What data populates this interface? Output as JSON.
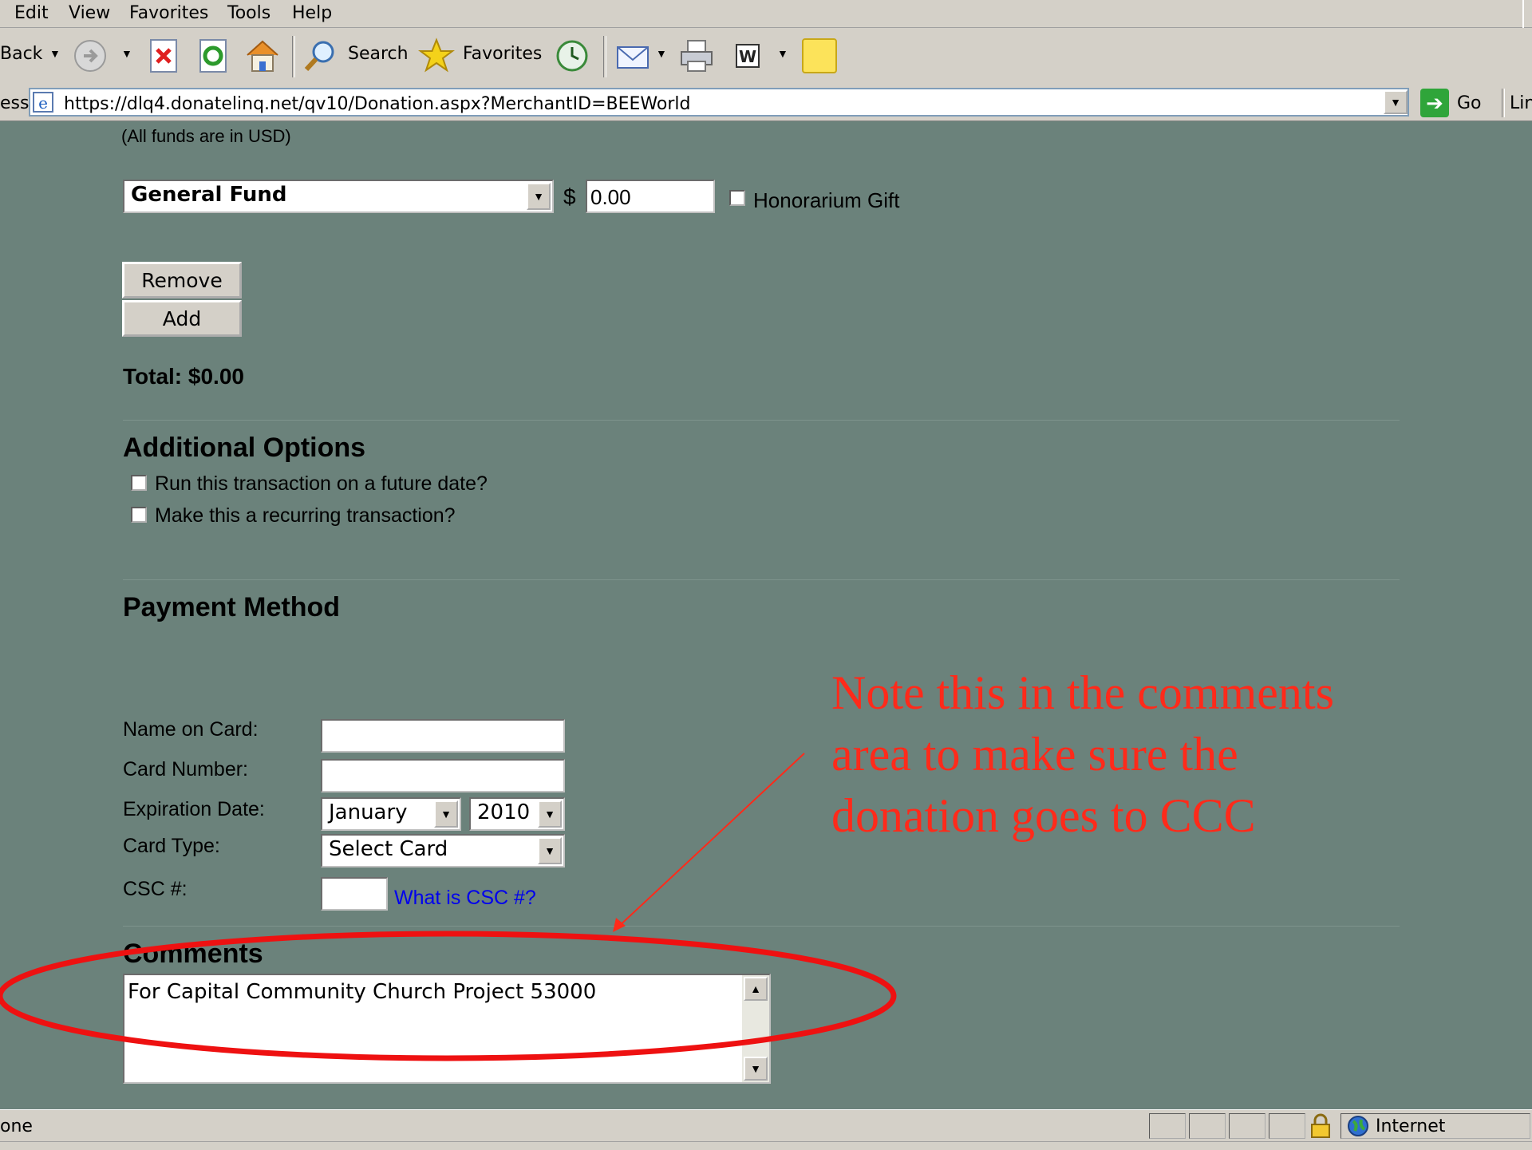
{
  "menu": [
    "Edit",
    "View",
    "Favorites",
    "Tools",
    "Help"
  ],
  "toolbar": {
    "back_label": "Back",
    "search_label": "Search",
    "favorites_label": "Favorites"
  },
  "address": {
    "label": "ess",
    "url": "https://dlq4.donatelinq.net/qv10/Donation.aspx?MerchantID=BEEWorld",
    "go_label": "Go",
    "links_label": "Lin"
  },
  "form": {
    "funds_note": "(All funds are in USD)",
    "fund_select": "General Fund",
    "currency": "$",
    "amount": "0.00",
    "honorarium_label": "Honorarium Gift",
    "remove_label": "Remove",
    "add_label": "Add",
    "total": "Total: $0.00",
    "additional_heading": "Additional Options",
    "future_date_label": "Run this transaction on a future date?",
    "recurring_label": "Make this a recurring transaction?",
    "payment_heading": "Payment Method",
    "name_label": "Name on Card:",
    "card_number_label": "Card Number:",
    "expiration_label": "Expiration Date:",
    "exp_month": "January",
    "exp_year": "2010",
    "card_type_label": "Card Type:",
    "card_type": "Select Card",
    "csc_label": "CSC #:",
    "csc_link": "What is CSC #?",
    "comments_heading": "Comments",
    "comments_value": "For Capital Community Church Project 53000"
  },
  "annotation": {
    "lines": [
      "Note this in the comments",
      "area to make sure the",
      "donation goes to CCC"
    ],
    "color": "#ff2a1a",
    "ellipse_color": "#ee1111"
  },
  "status": {
    "text": "one",
    "zone": "Internet"
  }
}
